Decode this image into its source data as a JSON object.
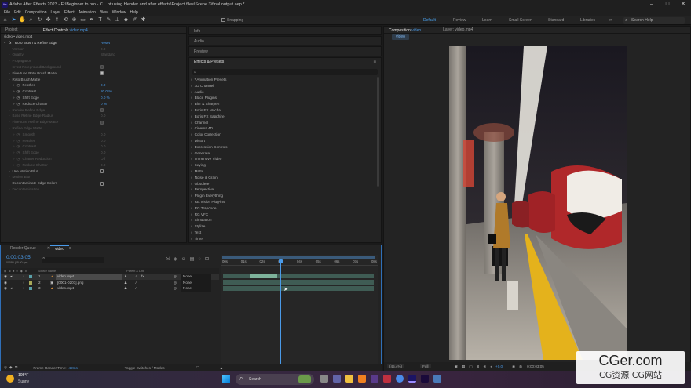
{
  "window": {
    "title": "Adobe After Effects 2023 - E:\\Beginner to pro - C... nt using blender and after effects\\Project files\\Scene 3\\final output.aep *",
    "logo": "Ae",
    "min": "–",
    "max": "□",
    "close": "✕"
  },
  "menu": [
    "File",
    "Edit",
    "Composition",
    "Layer",
    "Effect",
    "Animation",
    "View",
    "Window",
    "Help"
  ],
  "toolbar": {
    "snapping_label": "Snapping",
    "workspaces": [
      {
        "label": "Default",
        "active": true
      },
      {
        "label": "Review",
        "active": false
      },
      {
        "label": "Learn",
        "active": false
      },
      {
        "label": "Small Screen",
        "active": false
      },
      {
        "label": "Standard",
        "active": false
      },
      {
        "label": "Libraries",
        "active": false
      }
    ],
    "more": "»",
    "search_placeholder": "Search Help"
  },
  "project_panel": {
    "tab_project": "Project",
    "tab_effect_controls_prefix": "Effect Controls ",
    "tab_effect_controls_file": "video.mp4",
    "breadcrumb": "video • video.mp4",
    "effect": {
      "name": "Roto Brush & Refine Edge",
      "reset": "Reset",
      "rows": [
        {
          "label": "Version",
          "value": "2.0",
          "dim": true,
          "indent": 1
        },
        {
          "label": "Quality",
          "value": "Standard",
          "dim": true,
          "indent": 1
        },
        {
          "label": "Propagation",
          "value": "",
          "dim": true,
          "indent": 1
        },
        {
          "label": "Invert Foreground/Background",
          "value": "",
          "dim": true,
          "indent": 1,
          "check": "dim"
        },
        {
          "label": "Fine-tune Roto Brush Matte",
          "value": "",
          "dim": false,
          "indent": 1,
          "check": "on"
        },
        {
          "label": "Roto Brush Matte",
          "value": "",
          "dim": false,
          "indent": 1
        },
        {
          "label": "Feather",
          "value": "0.0",
          "dim": false,
          "indent": 2,
          "blue": true
        },
        {
          "label": "Contrast",
          "value": "80.0 %",
          "dim": false,
          "indent": 2,
          "blue": true
        },
        {
          "label": "Shift Edge",
          "value": "0.0 %",
          "dim": false,
          "indent": 2,
          "blue": true
        },
        {
          "label": "Reduce Chatter",
          "value": "0 %",
          "dim": false,
          "indent": 2,
          "blue": true
        },
        {
          "label": "Render Refine Edge",
          "value": "",
          "dim": true,
          "indent": 1,
          "check": "dim"
        },
        {
          "label": "Base Refine Edge Radius",
          "value": "0.0",
          "dim": true,
          "indent": 1
        },
        {
          "label": "Fine-tune Refine Edge Matte",
          "value": "",
          "dim": true,
          "indent": 1,
          "check": "dim"
        },
        {
          "label": "Refine Edge Matte",
          "value": "",
          "dim": true,
          "indent": 1
        },
        {
          "label": "Smooth",
          "value": "0.0",
          "dim": true,
          "indent": 2
        },
        {
          "label": "Feather",
          "value": "0.0",
          "dim": true,
          "indent": 2
        },
        {
          "label": "Contrast",
          "value": "0.0",
          "dim": true,
          "indent": 2
        },
        {
          "label": "Shift Edge",
          "value": "0.0",
          "dim": true,
          "indent": 2
        },
        {
          "label": "Chatter Reduction",
          "value": "Off",
          "dim": true,
          "indent": 2
        },
        {
          "label": "Reduce Chatter",
          "value": "0.0",
          "dim": true,
          "indent": 2
        },
        {
          "label": "Use Motion Blur",
          "value": "",
          "dim": false,
          "indent": 1,
          "check": "off"
        },
        {
          "label": "Motion Blur",
          "value": "",
          "dim": true,
          "indent": 1
        },
        {
          "label": "Decontaminate Edge Colors",
          "value": "",
          "dim": false,
          "indent": 1,
          "check": "off"
        },
        {
          "label": "Decontamination",
          "value": "",
          "dim": true,
          "indent": 1
        }
      ]
    }
  },
  "mid_panel": {
    "info": "Info",
    "audio": "Audio",
    "preview": "Preview",
    "fx_title": "Effects & Presets",
    "search_placeholder": "",
    "categories": [
      "* Animation Presets",
      "3D Channel",
      "Audio",
      "Blace Plugins",
      "Blur & Sharpen",
      "Boris FX Mocha",
      "Boris FX Sapphire",
      "Channel",
      "Cinema 4D",
      "Color Correction",
      "Distort",
      "Expression Controls",
      "Generate",
      "Immersive Video",
      "Keying",
      "Matte",
      "Noise & Grain",
      "Obsolete",
      "Perspective",
      "Plugin Everything",
      "RE:Vision Plug-ins",
      "RG Trapcode",
      "RG VFX",
      "Simulation",
      "Stylize",
      "Text",
      "Time"
    ]
  },
  "comp_panel": {
    "tab_comp_prefix": "Composition ",
    "tab_comp_name": "video",
    "tab_layer": "Layer: video.mp4",
    "sub_tab": "video",
    "zoom": "(45.4%)",
    "resolution": "Full",
    "exposure": "+0.0",
    "timecode": "0:00:03:05"
  },
  "timeline": {
    "tab_render_queue": "Render Queue",
    "tab_video": "video",
    "timecode": "0:00:03:05",
    "frames": "00080 (25.00 fps)",
    "header_source": "Source Name",
    "header_parent": "Parent & Link",
    "ruler": [
      "00s",
      "01s",
      "02s",
      "03s",
      "04s",
      "05s",
      "06s",
      "07s",
      "08s"
    ],
    "layers": [
      {
        "num": "1",
        "name": "video.mp4",
        "parent": "None",
        "selected": true
      },
      {
        "num": "2",
        "name": "[0001-0201].png",
        "parent": "None",
        "selected": false
      },
      {
        "num": "3",
        "name": "video.mp4",
        "parent": "None",
        "selected": false
      }
    ],
    "render_time_label": "Frame Render Time:",
    "render_time_value": "42ms",
    "toggle_label": "Toggle Switches / Modes",
    "playhead_fraction": 0.39
  },
  "taskbar": {
    "weather_temp": "105°F",
    "weather_desc": "Sunny",
    "search_label": "Search",
    "watermark_title": "CGer.com",
    "watermark_sub": "CG资源 CG网站"
  },
  "colors": {
    "accent": "#4a9ae8",
    "timeline_clip": "#5f8f78",
    "taskbar": "#2a1d3a"
  }
}
